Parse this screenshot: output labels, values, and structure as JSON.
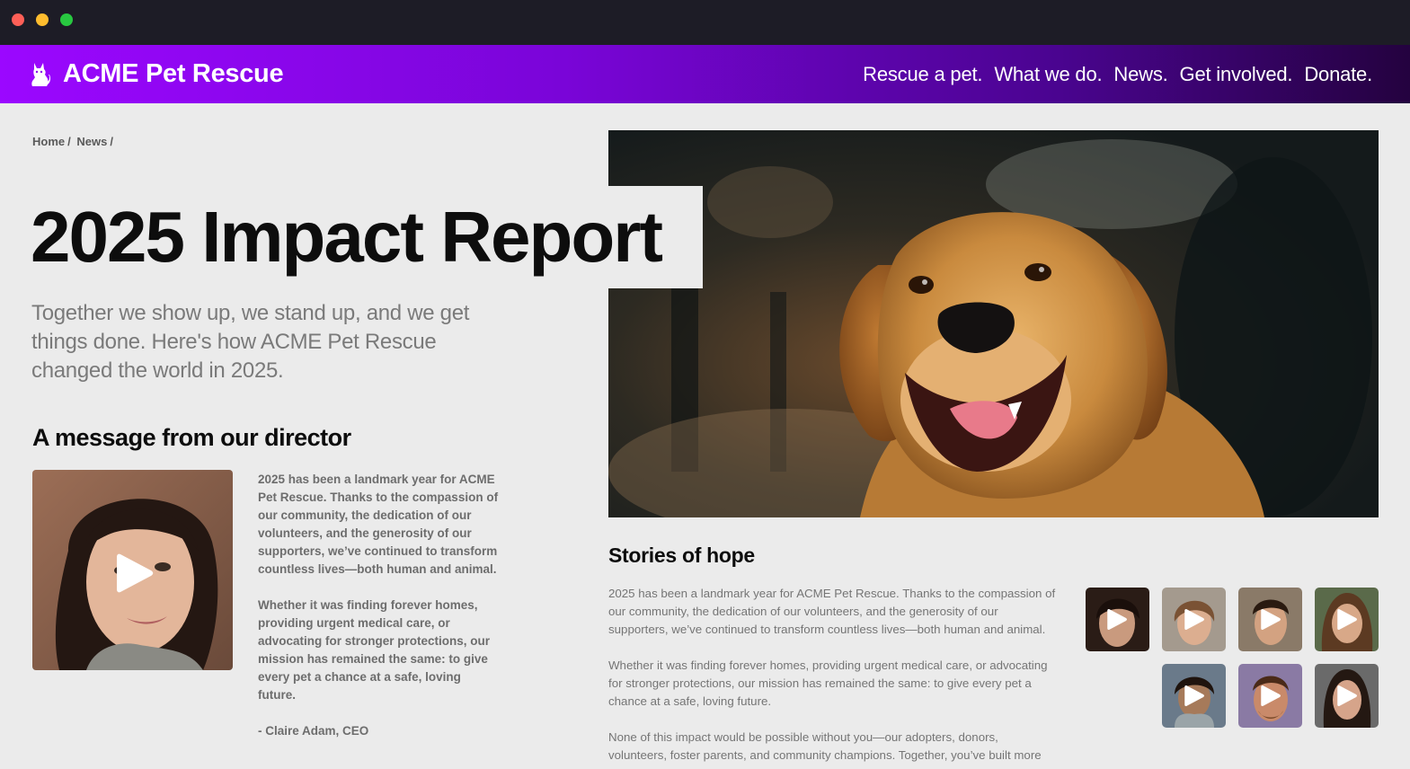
{
  "nav": {
    "brand": "ACME Pet Rescue",
    "links": [
      "Rescue a pet.",
      "What we do.",
      "News.",
      "Get involved.",
      "Donate."
    ]
  },
  "breadcrumb": [
    "Home",
    "/",
    "News",
    "/"
  ],
  "page_title": "2025 Impact Report",
  "lede": "Together we show up, we stand up, and we get things done. Here's how ACME Pet Rescue changed the world in 2025.",
  "director": {
    "heading": "A message from our director",
    "paragraphs": [
      "2025 has been a landmark year for ACME Pet Rescue. Thanks to the compassion of our community, the dedication of our volunteers, and the generosity of our supporters, we’ve continued to transform countless lives—both human and animal.",
      "Whether it was finding forever homes, providing urgent medical care, or advocating for stronger protections, our mission has remained the same: to give every pet a chance at a safe, loving future.",
      "- Claire Adam, CEO"
    ]
  },
  "stories": {
    "heading": "Stories of hope",
    "paragraphs": [
      "2025 has been a landmark year for ACME Pet Rescue. Thanks to the compassion of our community, the dedication of our volunteers, and the generosity of our supporters, we’ve continued to transform countless lives—both human and animal.",
      "Whether it was finding forever homes, providing urgent medical care, or advocating for stronger protections, our mission has remained the same: to give every pet a chance at a safe, loving future.",
      "None of this impact would be possible without you—our adopters, donors, volunteers, foster parents, and community champions. Together, you’ve built more"
    ]
  },
  "colors": {
    "nav_gradient_start": "#9b07ff",
    "nav_gradient_end": "#24023f",
    "page_bg": "#ebebeb"
  },
  "icons": {
    "brand": "pet-logo-icon",
    "play": "play-icon"
  }
}
